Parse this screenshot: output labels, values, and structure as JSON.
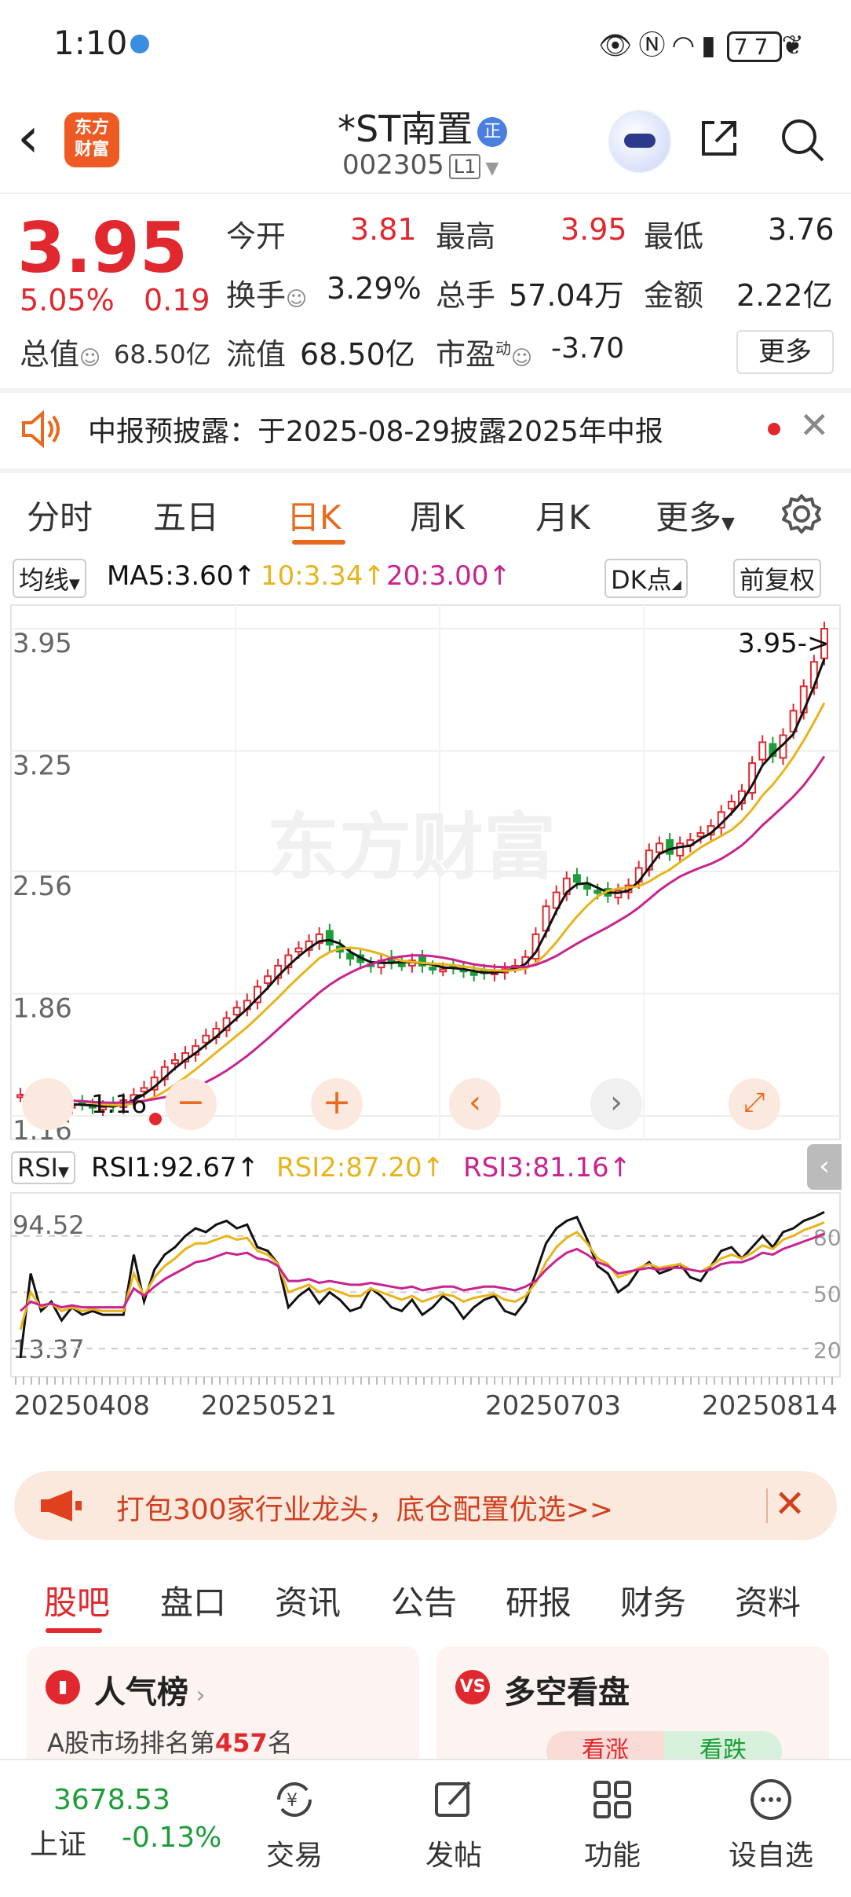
{
  "status_bar": {
    "time": "1:10",
    "battery": "77"
  },
  "header": {
    "name": "*ST南置",
    "badge": "正",
    "code": "002305",
    "level": "L1"
  },
  "quote": {
    "price": "3.95",
    "change_pct": "5.05%",
    "change": "0.19",
    "open_label": "今开",
    "open": "3.81",
    "high_label": "最高",
    "high": "3.95",
    "low_label": "最低",
    "low": "3.76",
    "turnover_label": "换手",
    "turnover": "3.29%",
    "volume_label": "总手",
    "volume": "57.04万",
    "amount_label": "金额",
    "amount": "2.22亿",
    "mcap_label": "总值",
    "mcap": "68.50亿",
    "float_label": "流值",
    "float_val": "68.50亿",
    "pe_label": "市盈",
    "pe_sup": "动",
    "pe": "-3.70",
    "more": "更多"
  },
  "notice": {
    "text": "中报预披露：于2025-08-29披露2025年中报"
  },
  "tabs": [
    "分时",
    "五日",
    "日K",
    "周K",
    "月K",
    "更多"
  ],
  "active_tab": "日K",
  "kline_bar": {
    "ma_select": "均线",
    "ma5": "MA5:3.60↑",
    "ma10": "10:3.34↑",
    "ma20": "20:3.00↑",
    "dk": "DK点",
    "adjust": "前复权"
  },
  "rsi_bar": {
    "select": "RSI",
    "rsi1": "RSI1:92.67↑",
    "rsi2": "RSI2:87.20↑",
    "rsi3": "RSI3:81.16↑"
  },
  "watermark": "东方财富",
  "colors": {
    "up": "#e0282e",
    "down": "#1d9d3a",
    "ma5": "#111111",
    "ma10": "#e8b41a",
    "ma20": "#c8238f",
    "accent": "#e86a1e"
  },
  "chart_data": [
    {
      "type": "candlestick",
      "y_ticks": [
        "3.95",
        "3.25",
        "2.56",
        "1.86",
        "1.16"
      ],
      "ylim": [
        1.16,
        3.95
      ],
      "last_label": "3.95->",
      "low_label": "1.16",
      "x_dates": [
        "20250408",
        "20250521",
        "20250703",
        "20250814"
      ],
      "ma5_close_series": [
        1.28,
        1.27,
        1.25,
        1.24,
        1.22,
        1.22,
        1.23,
        1.21,
        1.21,
        1.22,
        1.25,
        1.28,
        1.32,
        1.38,
        1.44,
        1.48,
        1.52,
        1.56,
        1.62,
        1.66,
        1.72,
        1.78,
        1.82,
        1.9,
        1.96,
        2.02,
        2.08,
        2.12,
        2.16,
        2.2,
        2.14,
        2.1,
        2.06,
        2.04,
        2.02,
        2.05,
        2.04,
        2.03,
        2.05,
        2.02,
        2.01,
        2.0,
        2.01,
        1.99,
        1.97,
        1.98,
        1.99,
        2.0,
        2.02,
        2.07,
        2.2,
        2.36,
        2.44,
        2.52,
        2.5,
        2.46,
        2.44,
        2.42,
        2.45,
        2.48,
        2.58,
        2.68,
        2.72,
        2.66,
        2.72,
        2.74,
        2.78,
        2.82,
        2.9,
        2.96,
        3.02,
        3.18,
        3.3,
        3.22,
        3.34,
        3.48,
        3.62,
        3.76,
        3.95
      ]
    },
    {
      "type": "line",
      "title": "RSI",
      "y_ticks": [
        "94.52",
        "13.37"
      ],
      "right_ticks": [
        "80",
        "50",
        "20"
      ],
      "ylim": [
        13.37,
        94.52
      ],
      "series": [
        {
          "name": "RSI1",
          "values": [
            15,
            60,
            40,
            45,
            35,
            42,
            38,
            40,
            38,
            38,
            38,
            70,
            45,
            62,
            70,
            74,
            80,
            84,
            82,
            86,
            88,
            84,
            86,
            74,
            72,
            65,
            42,
            48,
            52,
            44,
            50,
            46,
            40,
            42,
            52,
            48,
            42,
            40,
            46,
            38,
            42,
            48,
            44,
            36,
            42,
            46,
            48,
            40,
            38,
            45,
            60,
            76,
            84,
            88,
            90,
            78,
            64,
            60,
            50,
            54,
            62,
            66,
            60,
            62,
            65,
            58,
            56,
            64,
            72,
            74,
            68,
            74,
            80,
            74,
            82,
            84,
            88,
            90,
            92.67
          ]
        },
        {
          "name": "RSI2",
          "values": [
            30,
            50,
            42,
            44,
            40,
            42,
            40,
            41,
            40,
            40,
            40,
            60,
            48,
            58,
            64,
            68,
            73,
            76,
            76,
            78,
            80,
            78,
            79,
            72,
            70,
            65,
            50,
            52,
            54,
            50,
            52,
            50,
            48,
            48,
            52,
            50,
            48,
            46,
            48,
            45,
            47,
            49,
            48,
            45,
            47,
            48,
            49,
            46,
            45,
            48,
            55,
            66,
            74,
            79,
            82,
            76,
            68,
            65,
            58,
            60,
            63,
            65,
            63,
            64,
            65,
            62,
            61,
            64,
            68,
            70,
            68,
            71,
            75,
            73,
            78,
            80,
            83,
            85,
            87.2
          ]
        },
        {
          "name": "RSI3",
          "values": [
            40,
            45,
            43,
            44,
            42,
            43,
            42,
            42,
            42,
            42,
            42,
            52,
            48,
            53,
            57,
            60,
            63,
            66,
            67,
            69,
            71,
            70,
            71,
            68,
            67,
            64,
            56,
            56,
            57,
            55,
            56,
            55,
            54,
            54,
            55,
            54,
            53,
            52,
            53,
            51,
            52,
            53,
            53,
            51,
            52,
            53,
            53,
            52,
            51,
            53,
            56,
            62,
            67,
            71,
            73,
            70,
            66,
            64,
            60,
            61,
            62,
            63,
            62,
            63,
            63,
            62,
            61,
            62,
            65,
            66,
            66,
            68,
            71,
            70,
            73,
            75,
            77,
            79,
            81.16
          ]
        }
      ]
    }
  ],
  "banner": {
    "text": "打包300家行业龙头，底仓配置优选>>"
  },
  "section_tabs": [
    "股吧",
    "盘口",
    "资讯",
    "公告",
    "研报",
    "财务",
    "资料"
  ],
  "cards": {
    "popularity_title": "人气榜",
    "popularity_sub_prefix": "A股市场排名第",
    "popularity_rank": "457",
    "popularity_sub_suffix": "名",
    "bullbear_title": "多空看盘",
    "bull": "看涨",
    "bear": "看跌"
  },
  "bottom": {
    "index_val": "3678.53",
    "index_name": "上证",
    "index_chg": "-0.13%",
    "nav": [
      "交易",
      "发帖",
      "功能",
      "设自选"
    ]
  }
}
